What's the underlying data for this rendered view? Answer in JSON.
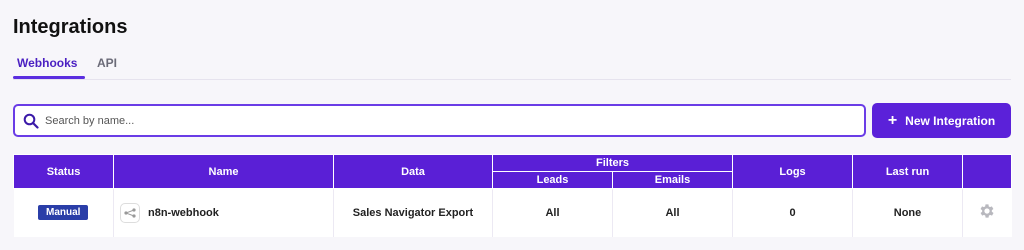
{
  "page": {
    "title": "Integrations"
  },
  "tabs": [
    {
      "label": "Webhooks",
      "active": true
    },
    {
      "label": "API",
      "active": false
    }
  ],
  "search": {
    "placeholder": "Search by name...",
    "value": ""
  },
  "toolbar": {
    "new_integration_label": "New Integration"
  },
  "table": {
    "headers": {
      "status": "Status",
      "name": "Name",
      "data": "Data",
      "filters": "Filters",
      "leads": "Leads",
      "emails": "Emails",
      "logs": "Logs",
      "last_run": "Last run"
    },
    "rows": [
      {
        "status": "Manual",
        "name": "n8n-webhook",
        "data": "Sales Navigator Export",
        "leads": "All",
        "emails": "All",
        "logs": "0",
        "last_run": "None"
      }
    ]
  },
  "colors": {
    "accent": "#5b21d9",
    "header_bg": "#5a1fd6",
    "status_badge": "#2a3ea8",
    "active_tab": "#4a1fc2"
  },
  "icons": {
    "search": "search-icon",
    "add": "plus-icon",
    "webhook": "webhook-icon",
    "settings": "gear-icon"
  }
}
